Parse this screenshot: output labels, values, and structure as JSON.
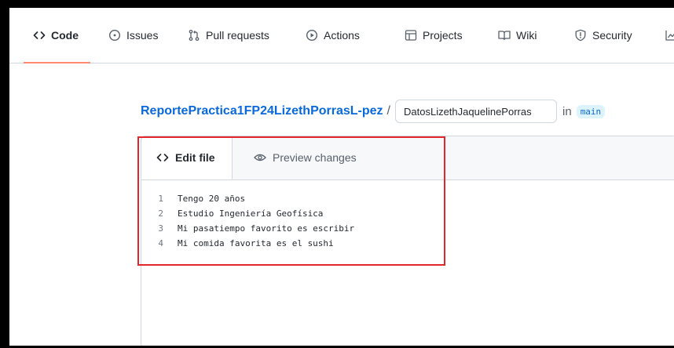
{
  "repo_nav": {
    "tabs": [
      {
        "label": "Code",
        "icon": "code-icon",
        "active": true
      },
      {
        "label": "Issues",
        "icon": "issue-opened-icon"
      },
      {
        "label": "Pull requests",
        "icon": "git-pull-request-icon"
      },
      {
        "label": "Actions",
        "icon": "play-icon"
      },
      {
        "label": "Projects",
        "icon": "table-icon"
      },
      {
        "label": "Wiki",
        "icon": "book-icon"
      },
      {
        "label": "Security",
        "icon": "shield-icon"
      }
    ]
  },
  "breadcrumb": {
    "repo": "ReportePractica1FP24LizethPorrasL-pez",
    "separator": "/",
    "filename_value": "DatosLizethJaquelinePorras",
    "in_label": "in",
    "branch": "main"
  },
  "editor": {
    "tabs": {
      "edit": "Edit file",
      "preview": "Preview changes"
    },
    "lines": [
      {
        "num": "1",
        "text": "Tengo 20 años"
      },
      {
        "num": "2",
        "text": "Estudio Ingeniería Geofísica"
      },
      {
        "num": "3",
        "text": "Mi pasatiempo favorito es escribir"
      },
      {
        "num": "4",
        "text": "Mi comida favorita es el sushi"
      }
    ]
  },
  "colors": {
    "link": "#0969da",
    "active_tab_underline": "#fd8c73",
    "highlight_box": "#e3262b",
    "branch_bg": "#ddf4ff"
  }
}
